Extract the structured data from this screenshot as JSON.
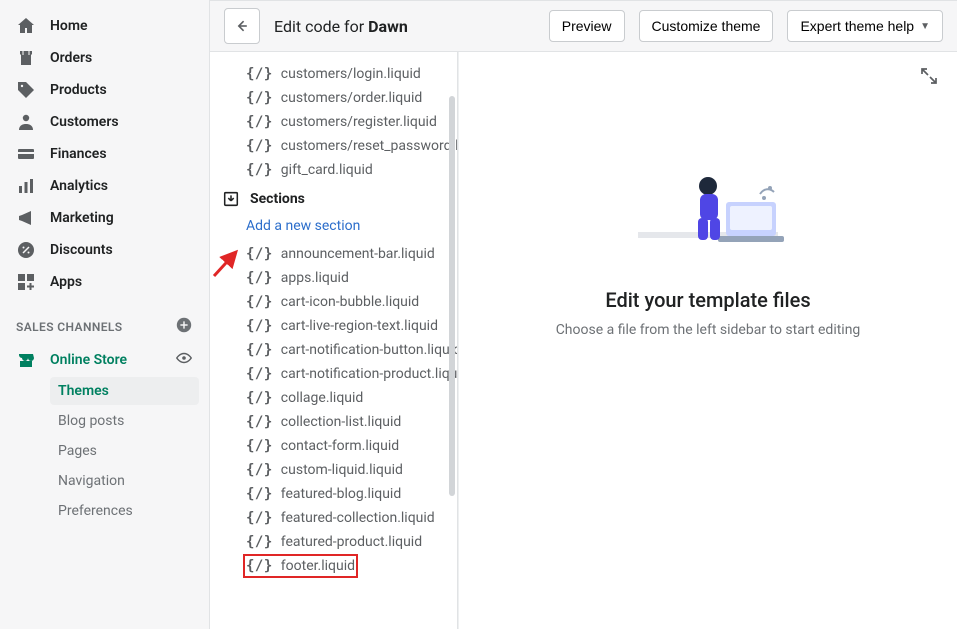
{
  "nav": {
    "items": [
      {
        "label": "Home",
        "icon": "home-icon"
      },
      {
        "label": "Orders",
        "icon": "orders-icon"
      },
      {
        "label": "Products",
        "icon": "tag-icon"
      },
      {
        "label": "Customers",
        "icon": "person-icon"
      },
      {
        "label": "Finances",
        "icon": "finances-icon"
      },
      {
        "label": "Analytics",
        "icon": "analytics-icon"
      },
      {
        "label": "Marketing",
        "icon": "megaphone-icon"
      },
      {
        "label": "Discounts",
        "icon": "discount-icon"
      },
      {
        "label": "Apps",
        "icon": "apps-icon"
      }
    ],
    "channels_label": "SALES CHANNELS",
    "online_store": "Online Store",
    "sub": [
      "Themes",
      "Blog posts",
      "Pages",
      "Navigation",
      "Preferences"
    ],
    "sub_selected": 0
  },
  "topbar": {
    "title_prefix": "Edit code for ",
    "title_bold": "Dawn",
    "buttons": {
      "preview": "Preview",
      "customize": "Customize theme",
      "help": "Expert theme help"
    }
  },
  "files": {
    "top_list": [
      "customers/login.liquid",
      "customers/order.liquid",
      "customers/register.liquid",
      "customers/reset_password.li",
      "gift_card.liquid"
    ],
    "section_label": "Sections",
    "add_section": "Add a new section",
    "section_list": [
      "announcement-bar.liquid",
      "apps.liquid",
      "cart-icon-bubble.liquid",
      "cart-live-region-text.liquid",
      "cart-notification-button.liquic",
      "cart-notification-product.liqu",
      "collage.liquid",
      "collection-list.liquid",
      "contact-form.liquid",
      "custom-liquid.liquid",
      "featured-blog.liquid",
      "featured-collection.liquid",
      "featured-product.liquid",
      "footer.liquid"
    ],
    "highlighted_index": 13
  },
  "editor": {
    "empty_title": "Edit your template files",
    "empty_sub": "Choose a file from the left sidebar to start editing"
  }
}
